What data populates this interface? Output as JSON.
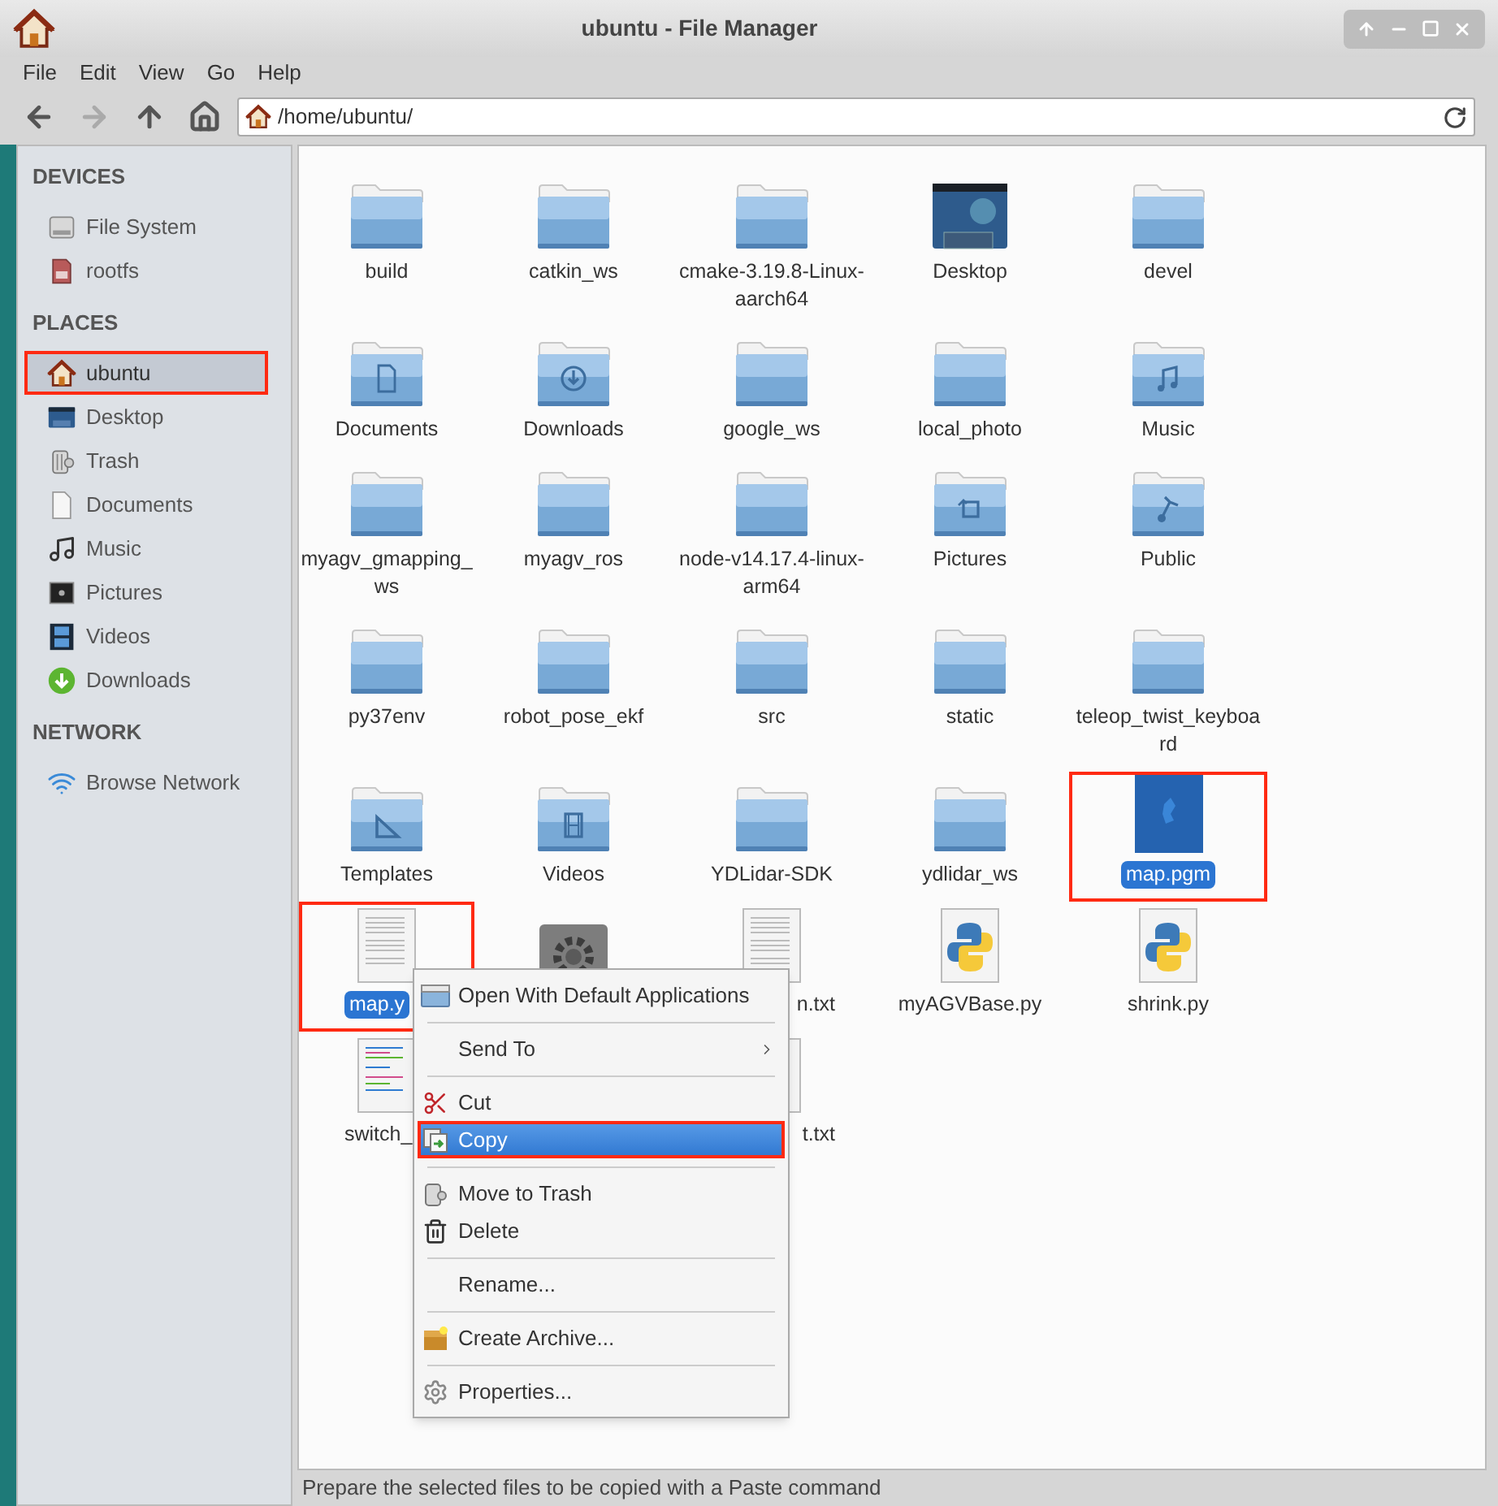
{
  "window": {
    "title": "ubuntu - File Manager"
  },
  "menu_bar": [
    "File",
    "Edit",
    "View",
    "Go",
    "Help"
  ],
  "toolbar": [
    {
      "kind": "back",
      "disabled": false
    },
    {
      "kind": "forward",
      "disabled": true
    },
    {
      "kind": "up",
      "disabled": false
    },
    {
      "kind": "home",
      "disabled": false
    }
  ],
  "location": {
    "value": "/home/ubuntu/"
  },
  "sidebar": [
    {
      "heading": "DEVICES",
      "items": [
        {
          "label": "File System",
          "kind": "drive",
          "selected": false,
          "annotated": false
        },
        {
          "label": "rootfs",
          "kind": "sdcard",
          "selected": false,
          "annotated": false
        }
      ]
    },
    {
      "heading": "PLACES",
      "items": [
        {
          "label": "ubuntu",
          "kind": "home",
          "selected": true,
          "annotated": true
        },
        {
          "label": "Desktop",
          "kind": "desktop",
          "selected": false,
          "annotated": false
        },
        {
          "label": "Trash",
          "kind": "trash",
          "selected": false,
          "annotated": false
        },
        {
          "label": "Documents",
          "kind": "document",
          "selected": false,
          "annotated": false
        },
        {
          "label": "Music",
          "kind": "music",
          "selected": false,
          "annotated": false
        },
        {
          "label": "Pictures",
          "kind": "pictures",
          "selected": false,
          "annotated": false
        },
        {
          "label": "Videos",
          "kind": "videos",
          "selected": false,
          "annotated": false
        },
        {
          "label": "Downloads",
          "kind": "downloads",
          "selected": false,
          "annotated": false
        }
      ]
    },
    {
      "heading": "NETWORK",
      "items": [
        {
          "label": "Browse Network",
          "kind": "network",
          "selected": false,
          "annotated": false
        }
      ]
    }
  ],
  "files": [
    {
      "name": "build",
      "kind": "folder",
      "selected": false,
      "annotated": false
    },
    {
      "name": "catkin_ws",
      "kind": "folder",
      "selected": false,
      "annotated": false
    },
    {
      "name": "cmake-3.19.8-Linux-aarch64",
      "kind": "folder",
      "selected": false,
      "annotated": false
    },
    {
      "name": "Desktop",
      "kind": "desktop",
      "selected": false,
      "annotated": false
    },
    {
      "name": "devel",
      "kind": "folder",
      "selected": false,
      "annotated": false
    },
    {
      "name": "Documents",
      "kind": "documents",
      "selected": false,
      "annotated": false
    },
    {
      "name": "Downloads",
      "kind": "downloads",
      "selected": false,
      "annotated": false
    },
    {
      "name": "google_ws",
      "kind": "folder",
      "selected": false,
      "annotated": false
    },
    {
      "name": "local_photo",
      "kind": "folder",
      "selected": false,
      "annotated": false
    },
    {
      "name": "Music",
      "kind": "music",
      "selected": false,
      "annotated": false
    },
    {
      "name": "myagv_gmapping_ws",
      "kind": "folder",
      "selected": false,
      "annotated": false
    },
    {
      "name": "myagv_ros",
      "kind": "folder",
      "selected": false,
      "annotated": false
    },
    {
      "name": "node-v14.17.4-linux-arm64",
      "kind": "folder",
      "selected": false,
      "annotated": false
    },
    {
      "name": "Pictures",
      "kind": "pictures",
      "selected": false,
      "annotated": false
    },
    {
      "name": "Public",
      "kind": "public",
      "selected": false,
      "annotated": false
    },
    {
      "name": "py37env",
      "kind": "folder",
      "selected": false,
      "annotated": false
    },
    {
      "name": "robot_pose_ekf",
      "kind": "folder",
      "selected": false,
      "annotated": false
    },
    {
      "name": "src",
      "kind": "folder",
      "selected": false,
      "annotated": false
    },
    {
      "name": "static",
      "kind": "folder",
      "selected": false,
      "annotated": false
    },
    {
      "name": "teleop_twist_keyboard",
      "kind": "folder",
      "selected": false,
      "annotated": false
    },
    {
      "name": "Templates",
      "kind": "templates",
      "selected": false,
      "annotated": false
    },
    {
      "name": "Videos",
      "kind": "videos",
      "selected": false,
      "annotated": false
    },
    {
      "name": "YDLidar-SDK",
      "kind": "folder",
      "selected": false,
      "annotated": false
    },
    {
      "name": "ydlidar_ws",
      "kind": "folder",
      "selected": false,
      "annotated": false
    },
    {
      "name": "map.pgm",
      "kind": "image",
      "selected": true,
      "annotated": true
    },
    {
      "name": "map.y",
      "kind": "text",
      "cut_at_end": true,
      "selected": true,
      "annotated": true
    },
    {
      "kind": "executable"
    },
    {
      "name": "n.txt",
      "kind": "text",
      "cut_at_start": true,
      "selected": false,
      "annotated": false
    },
    {
      "name": "myAGVBase.py",
      "kind": "python",
      "selected": false,
      "annotated": false
    },
    {
      "name": "shrink.py",
      "kind": "python",
      "selected": false,
      "annotated": false
    },
    {
      "name": "switch_",
      "kind": "colortext",
      "cut_at_end": true,
      "selected": false,
      "annotated": false
    },
    {
      "kind": "covered"
    },
    {
      "name": "t.txt",
      "kind": "text",
      "cut_at_start": true,
      "selected": false,
      "annotated": false
    }
  ],
  "context_menu": [
    {
      "kind": "folder",
      "label": "Open With Default Applications",
      "selected": false,
      "annotated": false,
      "submenu": false
    },
    {
      "kind": "separator"
    },
    {
      "kind": "plain",
      "label": "Send To",
      "selected": false,
      "annotated": false,
      "submenu": true
    },
    {
      "kind": "separator"
    },
    {
      "kind": "cut",
      "label": "Cut",
      "selected": false,
      "annotated": false,
      "submenu": false
    },
    {
      "kind": "copy",
      "label": "Copy",
      "selected": true,
      "annotated": true,
      "submenu": false
    },
    {
      "kind": "separator"
    },
    {
      "kind": "trash",
      "label": "Move to Trash",
      "selected": false,
      "annotated": false,
      "submenu": false
    },
    {
      "kind": "delete",
      "label": "Delete",
      "selected": false,
      "annotated": false,
      "submenu": false
    },
    {
      "kind": "separator"
    },
    {
      "kind": "plain",
      "label": "Rename...",
      "selected": false,
      "annotated": false,
      "submenu": false
    },
    {
      "kind": "separator"
    },
    {
      "kind": "archive",
      "label": "Create Archive...",
      "selected": false,
      "annotated": false,
      "submenu": false
    },
    {
      "kind": "separator"
    },
    {
      "kind": "properties",
      "label": "Properties...",
      "selected": false,
      "annotated": false,
      "submenu": false
    }
  ],
  "status_bar": "Prepare the selected files to be copied with a Paste command"
}
